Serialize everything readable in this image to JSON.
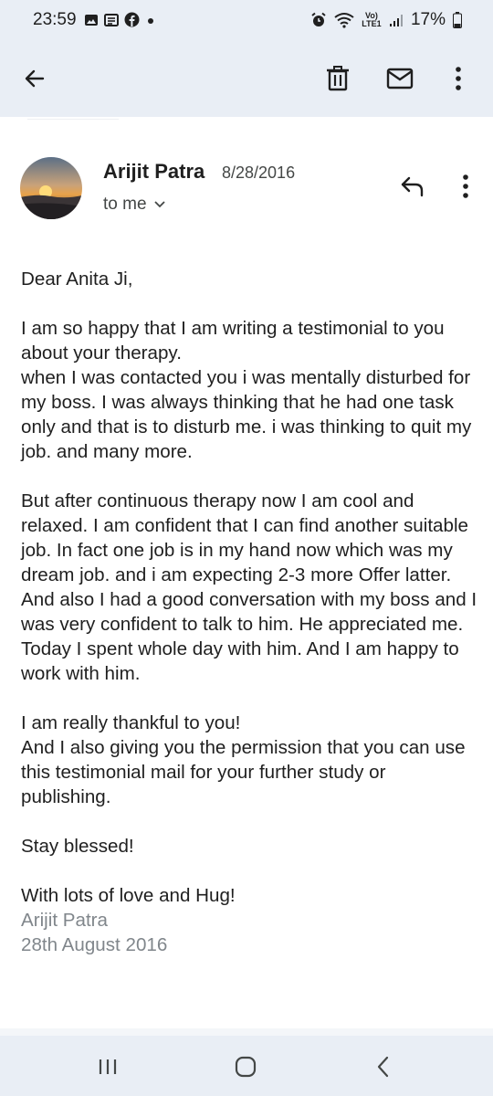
{
  "status_bar": {
    "time": "23:59",
    "network_label": "Vo) LTE1",
    "battery": "17%",
    "icons": [
      "gallery-icon",
      "news-icon",
      "facebook-icon",
      "dot-icon",
      "alarm-icon",
      "wifi-icon",
      "signal-icon",
      "battery-icon"
    ]
  },
  "toolbar": {
    "icons": [
      "back-arrow-icon",
      "trash-icon",
      "mail-icon",
      "more-vert-icon"
    ]
  },
  "email": {
    "sender": "Arijit Patra",
    "date": "8/28/2016",
    "recipient": "to me",
    "greeting": "Dear Anita Ji,",
    "paragraph1": "I am so happy that I am writing a testimonial to you about your therapy.\nwhen I was contacted you i was mentally disturbed for my boss. I was always thinking that he had one task only and that is to disturb me. i was thinking to quit my job. and many more.",
    "paragraph2": "But after continuous therapy now I am cool and relaxed. I am confident that I can find another suitable job. In fact one job is in my hand now which was my dream job. and i am expecting 2-3 more Offer latter.  And also I had a good conversation with my boss and I was very confident to talk to him. He appreciated me. Today I spent whole day with him. And I am happy to work with him.",
    "paragraph3": "I am really thankful to you!\nAnd I also giving you the permission that you can use this testimonial mail for your further study or publishing.",
    "blessing": "Stay blessed!",
    "closing": "With lots of love and Hug!",
    "signature_name": "Arijit Patra",
    "signature_date": "28th August 2016"
  },
  "nav_bar": {
    "icons": [
      "recents-icon",
      "home-icon",
      "back-icon"
    ]
  },
  "colors": {
    "bar_background": "#e9eef5",
    "text": "#1f1f1f",
    "muted_text": "#444746",
    "signature": "#80868b"
  }
}
